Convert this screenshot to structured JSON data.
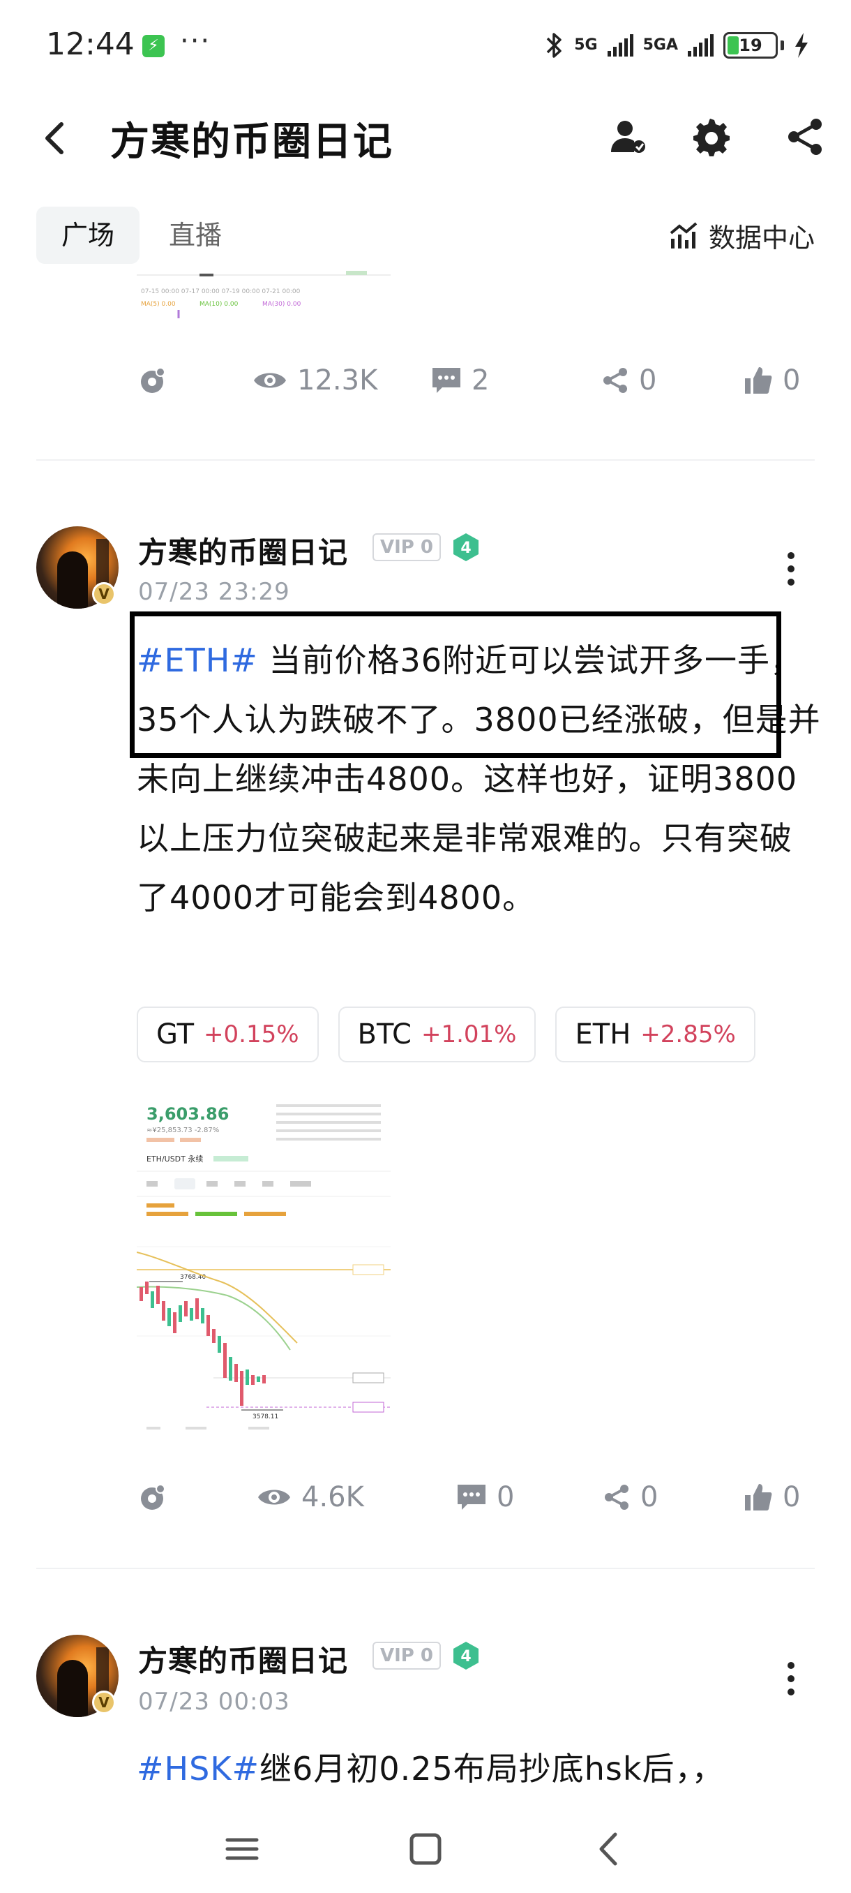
{
  "status_bar": {
    "time": "12:44",
    "dots": "···",
    "net1": "5G",
    "net2": "5GA",
    "battery": "19"
  },
  "header": {
    "title": "方寒的币圈日记"
  },
  "tabs": {
    "plaza": "广场",
    "live": "直播",
    "data_center": "数据中心"
  },
  "post_top": {
    "actions": {
      "views": "12.3K",
      "comments": "2",
      "shares": "0",
      "likes": "0"
    }
  },
  "post_eth": {
    "author": "方寒的币圈日记",
    "vip": "VIP 0",
    "level": "4",
    "time": "07/23 23:29",
    "hashtag": "#ETH#",
    "body": " 当前价格36附近可以尝试开多一手，35个人认为跌破不了。3800已经涨破，但是并未向上继续冲击4800。这样也好，证明3800以上压力位突破起来是非常艰难的。只有突破了4000才可能会到4800。",
    "coins": [
      {
        "symbol": "GT",
        "change": "+0.15%"
      },
      {
        "symbol": "BTC",
        "change": "+1.01%"
      },
      {
        "symbol": "ETH",
        "change": "+2.85%"
      }
    ],
    "thumbnail": {
      "price": "3,603.86",
      "sub": "≈¥25,853.73  -2.87%",
      "pair": "ETH/USDT 永续",
      "label_high": "3768.40",
      "label_low": "3578.11"
    },
    "actions": {
      "views": "4.6K",
      "comments": "0",
      "shares": "0",
      "likes": "0"
    }
  },
  "post_hsk": {
    "author": "方寒的币圈日记",
    "vip": "VIP 0",
    "level": "4",
    "time": "07/23 00:03",
    "hashtag": "#HSK#",
    "body": "继6月初0.25布局抄底hsk后，，"
  },
  "colors": {
    "hashtag": "#2f6ae0",
    "price_up": "#d2425c",
    "icon_gray": "#8a8e96",
    "level_badge": "#3dbf8f"
  }
}
